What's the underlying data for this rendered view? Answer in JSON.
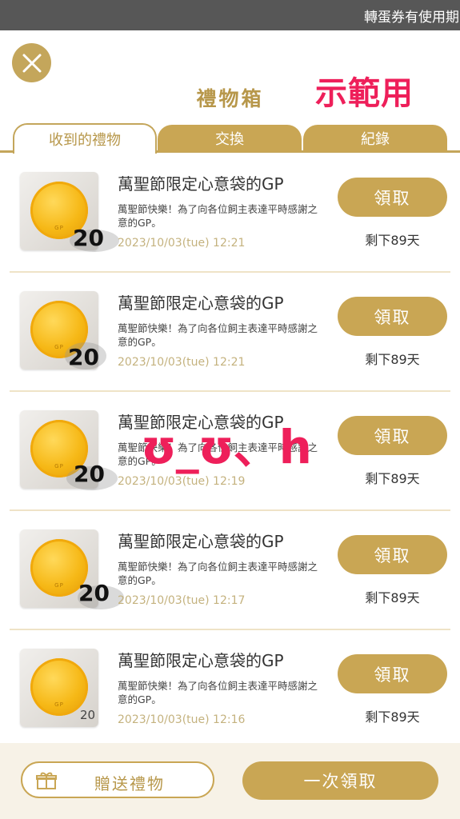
{
  "topbar": {
    "marquee": "轉蛋券有使用期限"
  },
  "header": {
    "title": "禮物箱",
    "stamp": "示範用"
  },
  "tabs": [
    {
      "label": "收到的禮物",
      "active": true
    },
    {
      "label": "交換",
      "active": false
    },
    {
      "label": "紀錄",
      "active": false
    }
  ],
  "items": [
    {
      "title": "萬聖節限定心意袋的GP",
      "desc": "萬聖節快樂！為了向各位飼主表達平時感謝之意的GP。",
      "time": "2023/10/03(tue) 12:21",
      "qty": "20",
      "claim": "領取",
      "remaining": "剩下89天"
    },
    {
      "title": "萬聖節限定心意袋的GP",
      "desc": "萬聖節快樂！為了向各位飼主表達平時感謝之意的GP。",
      "time": "2023/10/03(tue) 12:21",
      "qty": "20",
      "claim": "領取",
      "remaining": "剩下89天"
    },
    {
      "title": "萬聖節限定心意袋的GP",
      "desc": "萬聖節快樂！為了向各位飼主表達平時感謝之意的GP。",
      "time": "2023/10/03(tue) 12:19",
      "qty": "20",
      "claim": "領取",
      "remaining": "剩下89天"
    },
    {
      "title": "萬聖節限定心意袋的GP",
      "desc": "萬聖節快樂！為了向各位飼主表達平時感謝之意的GP。",
      "time": "2023/10/03(tue) 12:17",
      "qty": "20",
      "claim": "領取",
      "remaining": "剩下89天"
    },
    {
      "title": "萬聖節限定心意袋的GP",
      "desc": "萬聖節快樂！為了向各位飼主表達平時感謝之意的GP。",
      "time": "2023/10/03(tue) 12:16",
      "qty": "20",
      "claim": "領取",
      "remaining": "剩下89天"
    }
  ],
  "overlay_text": "ʊ_ʊ、h",
  "bottom": {
    "gift_label": "贈送禮物",
    "claim_all_label": "一次領取"
  },
  "colors": {
    "gold": "#c9a654",
    "gold_text": "#b7974a",
    "stamp": "#ee1f5a",
    "topbar": "#575757"
  },
  "icons": {
    "close": "close-icon",
    "gift": "gift-icon",
    "coin": "gp-coin-icon"
  }
}
